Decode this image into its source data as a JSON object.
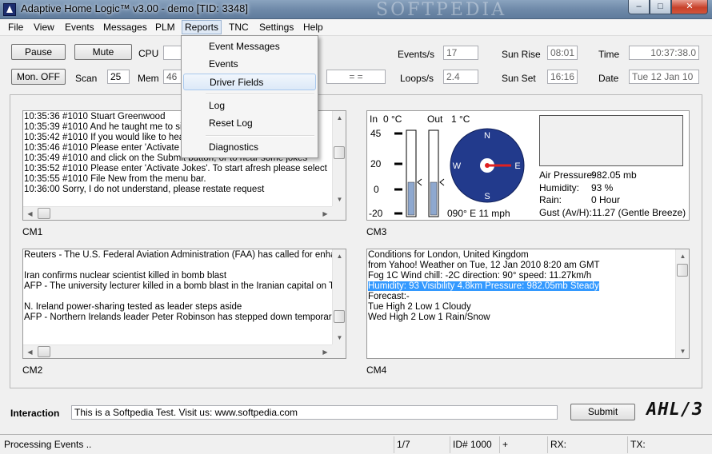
{
  "window": {
    "title": "Adaptive Home Logic™ v3.00 - demo [TID: 3348]",
    "watermark": "SOFTPEDIA",
    "controls": {
      "minimize": "–",
      "maximize": "□",
      "close": "✕"
    }
  },
  "menu": [
    "File",
    "View",
    "Events",
    "Messages",
    "PLM",
    "Reports",
    "TNC",
    "Settings",
    "Help"
  ],
  "reports_menu": {
    "items": [
      "Event Messages",
      "Events",
      "Driver Fields",
      "Log",
      "Reset Log",
      "Diagnostics"
    ],
    "hovered": "Driver Fields"
  },
  "toolbar": {
    "pause": "Pause",
    "mute": "Mute",
    "mon_off": "Mon. OFF",
    "cpu_label": "CPU",
    "scan_label": "Scan",
    "scan_value": "25",
    "mem_label": "Mem",
    "mem_value": "46",
    "equals_value": "=         =",
    "events_label": "Events/s",
    "events_value": "17",
    "loops_label": "Loops/s",
    "loops_value": "2.4",
    "sunrise_label": "Sun Rise",
    "sunrise_value": "08:01",
    "sunset_label": "Sun Set",
    "sunset_value": "16:16",
    "time_label": "Time",
    "time_value": "10:37:38.0",
    "date_label": "Date",
    "date_value": "Tue 12 Jan 10"
  },
  "cm1": {
    "caption": "CM1",
    "lines": [
      "10:35:36  #1010  Stuart Greenwood",
      "10:35:39  #1010  And he taught me to sing",
      "10:35:42  #1010  If you would like to hear some jokes",
      "10:35:46  #1010  Please enter 'Activate Jokes'",
      "10:35:49  #1010  and click on the Submit button, or to hear some jokes",
      "10:35:52  #1010  Please enter 'Activate Jokes'. To start afresh please select",
      "10:35:55  #1010  File New from the menu bar.",
      "10:36:00  Sorry, I do not understand, please restate request"
    ]
  },
  "cm2": {
    "caption": "CM2",
    "lines": [
      "Reuters - The U.S. Federal Aviation Administration (FAA) has called for enhanced",
      "",
      "Iran confirms nuclear scientist killed in bomb blast",
      "AFP - The university lecturer killed in a bomb blast in the Iranian capital on Tuesday",
      "",
      "N. Ireland power-sharing tested as leader steps aside",
      "AFP - Northern Irelands leader Peter Robinson has stepped down temporarily amid"
    ]
  },
  "cm3": {
    "caption": "CM3",
    "in_label": "In",
    "in_temp": "0 °C",
    "out_label": "Out",
    "out_temp": "1 °C",
    "scale": [
      "45",
      "20",
      "0",
      "-20"
    ],
    "in_level": 0.55,
    "out_level": 0.55,
    "compass": {
      "n": "N",
      "s": "S",
      "e": "E",
      "w": "W"
    },
    "wind": "090° E 11 mph",
    "wind_direction_deg": 90,
    "air_pressure_label": "Air Pressure:",
    "air_pressure": "982.05 mb",
    "humidity_label": "Humidity:",
    "humidity": "93 %",
    "rain_label": "Rain:",
    "rain": "0 Hour",
    "gust_label": "Gust (Av/H):",
    "gust": "11.27  (Gentle Breeze)",
    "colors": {
      "gauge_fill": "#8ea8cf",
      "compass": "#223a8c",
      "needle": "#e02020"
    }
  },
  "cm4": {
    "caption": "CM4",
    "lines": [
      "Conditions for London, United Kingdom",
      "from Yahoo! Weather on Tue, 12 Jan 2010 8:20 am GMT",
      "Fog 1C  Wind chill: -2C  direction: 90°  speed: 11.27km/h",
      "Humidity: 93  Visibility 4.8km  Pressure: 982.05mb  Steady",
      "Forecast:-",
      "Tue  High 2  Low 1  Cloudy",
      "Wed  High 2  Low 1  Rain/Snow"
    ],
    "selected_line": 3
  },
  "interaction": {
    "label": "Interaction",
    "value": "This is a Softpedia Test. Visit us: www.softpedia.com",
    "submit": "Submit",
    "logo": "AHL/3"
  },
  "statusbar": {
    "status": "Processing Events ..",
    "page": "1/7",
    "id": "ID# 1000",
    "plus": "+",
    "rx": "RX:",
    "tx": "TX:"
  }
}
